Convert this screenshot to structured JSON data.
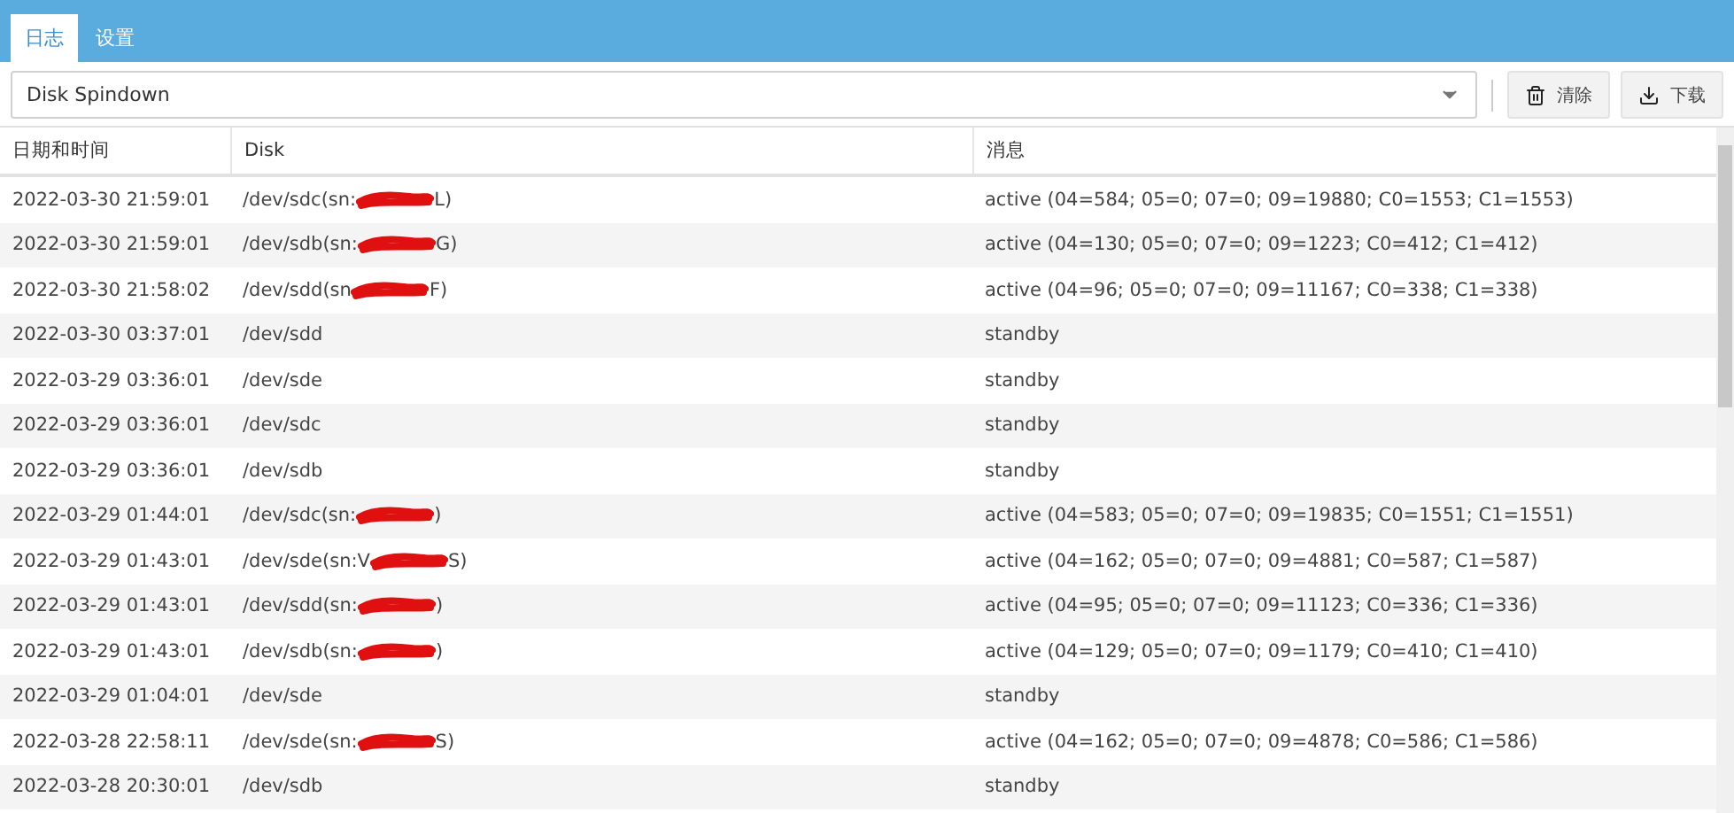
{
  "tabs": [
    {
      "label": "日志",
      "selected": true
    },
    {
      "label": "设置",
      "selected": false
    }
  ],
  "log_select": {
    "value": "Disk Spindown"
  },
  "buttons": [
    {
      "kind": "clear",
      "label": "清除"
    },
    {
      "kind": "download",
      "label": "下载"
    }
  ],
  "table": {
    "columns": [
      "日期和时间",
      "Disk",
      "消息"
    ],
    "rows": [
      {
        "time": "2022-03-30 21:59:01",
        "disk": "/dev/sdc(sn:",
        "redacted": true,
        "disk_tail": "L)",
        "message": "active (04=584; 05=0; 07=0; 09=19880; C0=1553; C1=1553)"
      },
      {
        "time": "2022-03-30 21:59:01",
        "disk": "/dev/sdb(sn:",
        "redacted": true,
        "disk_tail": "G)",
        "message": "active (04=130; 05=0; 07=0; 09=1223; C0=412; C1=412)"
      },
      {
        "time": "2022-03-30 21:58:02",
        "disk": "/dev/sdd(sn",
        "redacted": true,
        "disk_tail": "F)",
        "message": "active (04=96; 05=0; 07=0; 09=11167; C0=338; C1=338)"
      },
      {
        "time": "2022-03-30 03:37:01",
        "disk": "/dev/sdd",
        "redacted": false,
        "message": "standby"
      },
      {
        "time": "2022-03-29 03:36:01",
        "disk": "/dev/sde",
        "redacted": false,
        "message": "standby"
      },
      {
        "time": "2022-03-29 03:36:01",
        "disk": "/dev/sdc",
        "redacted": false,
        "message": "standby"
      },
      {
        "time": "2022-03-29 03:36:01",
        "disk": "/dev/sdb",
        "redacted": false,
        "message": "standby"
      },
      {
        "time": "2022-03-29 01:44:01",
        "disk": "/dev/sdc(sn:",
        "redacted": true,
        "disk_tail": ")",
        "message": "active (04=583; 05=0; 07=0; 09=19835; C0=1551; C1=1551)"
      },
      {
        "time": "2022-03-29 01:43:01",
        "disk": "/dev/sde(sn:V",
        "redacted": true,
        "disk_tail": "S)",
        "message": "active (04=162; 05=0; 07=0; 09=4881; C0=587; C1=587)"
      },
      {
        "time": "2022-03-29 01:43:01",
        "disk": "/dev/sdd(sn:",
        "redacted": true,
        "disk_tail": ")",
        "message": "active (04=95; 05=0; 07=0; 09=11123; C0=336; C1=336)"
      },
      {
        "time": "2022-03-29 01:43:01",
        "disk": "/dev/sdb(sn:",
        "redacted": true,
        "disk_tail": ")",
        "message": "active (04=129; 05=0; 07=0; 09=1179; C0=410; C1=410)"
      },
      {
        "time": "2022-03-29 01:04:01",
        "disk": "/dev/sde",
        "redacted": false,
        "message": "standby"
      },
      {
        "time": "2022-03-28 22:58:11",
        "disk": "/dev/sde(sn:",
        "redacted": true,
        "disk_tail": "S)",
        "message": "active (04=162; 05=0; 07=0; 09=4878; C0=586; C1=586)"
      },
      {
        "time": "2022-03-28 20:30:01",
        "disk": "/dev/sdb",
        "redacted": false,
        "message": "standby"
      }
    ]
  }
}
